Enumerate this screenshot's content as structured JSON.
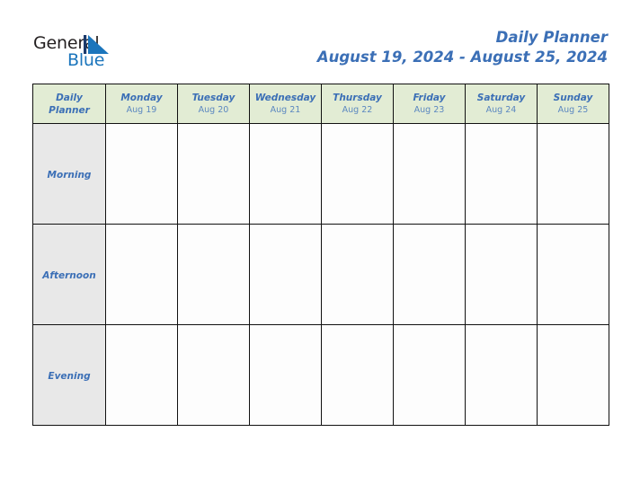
{
  "logo": {
    "word_dark": "General",
    "word_blue": "Blue",
    "mark": "triangle-logo-mark",
    "dark_color": "#231f20",
    "blue_color": "#1b75bc"
  },
  "header": {
    "title": "Daily Planner",
    "subtitle": "August 19, 2024 - August 25, 2024",
    "title_color": "#3b6fb6"
  },
  "table": {
    "corner": {
      "line1": "Daily",
      "line2": "Planner"
    },
    "header_bg": "#e2ecd4",
    "label_bg": "#e8e8e8",
    "border_color": "#111111",
    "columns": [
      {
        "day": "Monday",
        "date": "Aug 19"
      },
      {
        "day": "Tuesday",
        "date": "Aug 20"
      },
      {
        "day": "Wednesday",
        "date": "Aug 21"
      },
      {
        "day": "Thursday",
        "date": "Aug 22"
      },
      {
        "day": "Friday",
        "date": "Aug 23"
      },
      {
        "day": "Saturday",
        "date": "Aug 24"
      },
      {
        "day": "Sunday",
        "date": "Aug 25"
      }
    ],
    "rows": [
      {
        "label": "Morning",
        "cells": [
          "",
          "",
          "",
          "",
          "",
          "",
          ""
        ]
      },
      {
        "label": "Afternoon",
        "cells": [
          "",
          "",
          "",
          "",
          "",
          "",
          ""
        ]
      },
      {
        "label": "Evening",
        "cells": [
          "",
          "",
          "",
          "",
          "",
          "",
          ""
        ]
      }
    ]
  }
}
